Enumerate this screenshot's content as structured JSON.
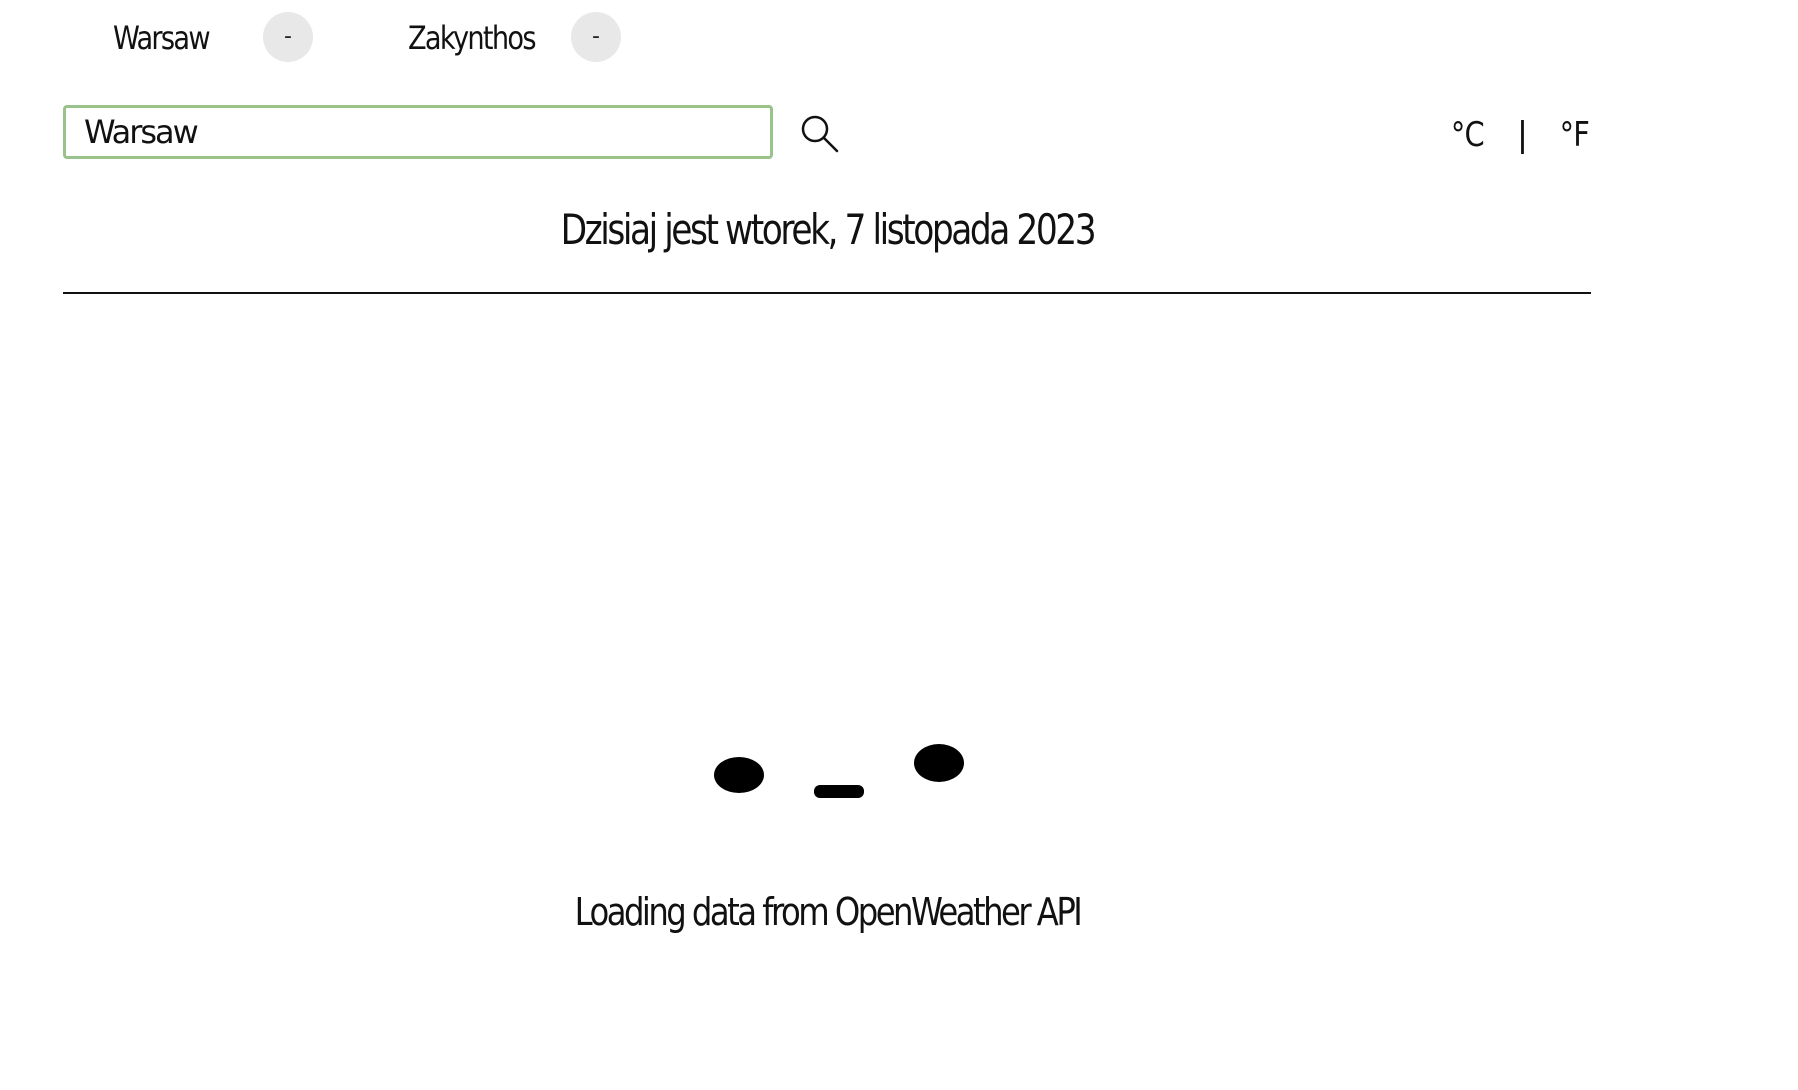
{
  "favorites": [
    {
      "city": "Warsaw",
      "remove_label": "-"
    },
    {
      "city": "Zakynthos",
      "remove_label": "-"
    }
  ],
  "search": {
    "value": "Warsaw",
    "button_icon": "search-icon"
  },
  "units": {
    "celsius": "°C",
    "separator": "|",
    "fahrenheit": "°F"
  },
  "date_text": "Dzisiaj jest wtorek, 7 listopada 2023",
  "loading": {
    "text": "Loading data from OpenWeather API"
  },
  "colors": {
    "input_border": "#98c48b",
    "remove_button_bg": "#e8e8e8",
    "text": "#111111"
  }
}
